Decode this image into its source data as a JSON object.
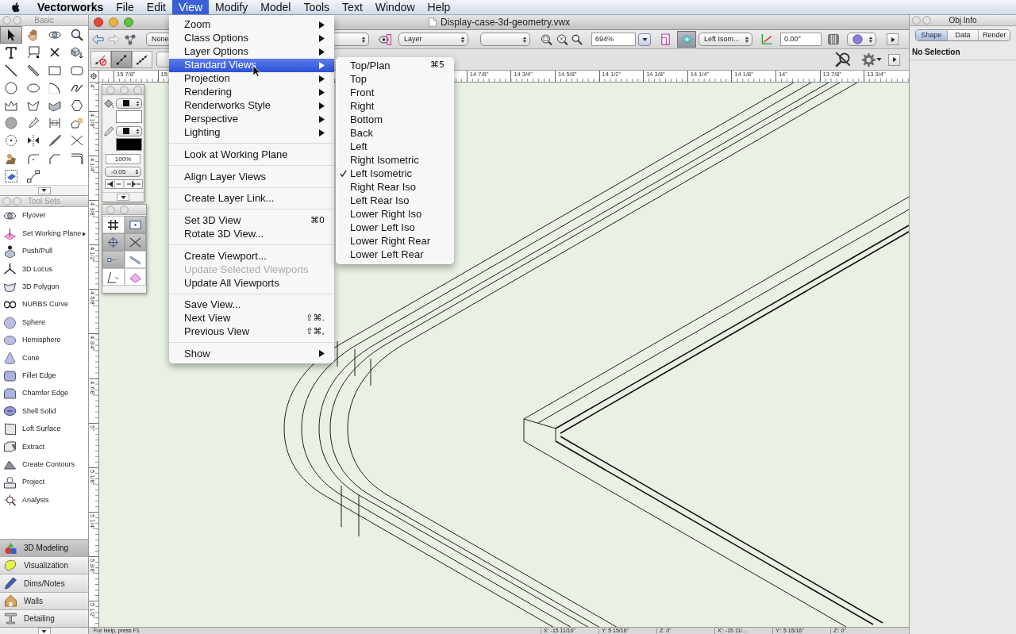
{
  "menu_bar": {
    "app_name": "Vectorworks",
    "menus": [
      {
        "label": "File",
        "selected": false
      },
      {
        "label": "Edit",
        "selected": false
      },
      {
        "label": "View",
        "selected": true
      },
      {
        "label": "Modify",
        "selected": false
      },
      {
        "label": "Model",
        "selected": false
      },
      {
        "label": "Tools",
        "selected": false
      },
      {
        "label": "Text",
        "selected": false
      },
      {
        "label": "Window",
        "selected": false
      },
      {
        "label": "Help",
        "selected": false
      }
    ]
  },
  "basic_palette": {
    "title": "Basic",
    "tools": [
      {
        "selected": true
      },
      {
        "selected": false
      },
      {
        "selected": false
      },
      {
        "selected": false
      },
      {
        "selected": false
      },
      {
        "selected": false
      },
      {
        "selected": false
      },
      {
        "selected": false
      },
      {
        "selected": false
      },
      {
        "selected": false
      },
      {
        "selected": false
      },
      {
        "selected": false
      },
      {
        "selected": false
      },
      {
        "selected": false
      },
      {
        "selected": false
      },
      {
        "selected": false
      },
      {
        "selected": false
      },
      {
        "selected": false
      },
      {
        "selected": false
      },
      {
        "selected": false
      },
      {
        "selected": false
      },
      {
        "selected": false
      },
      {
        "selected": false
      },
      {
        "selected": false
      },
      {
        "selected": false
      },
      {
        "selected": false
      },
      {
        "selected": false
      },
      {
        "selected": false
      },
      {
        "selected": false
      },
      {
        "selected": false
      },
      {
        "selected": false
      },
      {
        "selected": false
      },
      {
        "selected": false
      },
      {
        "selected": false
      }
    ]
  },
  "tool_sets_palette": {
    "title": "Tool Sets",
    "tools": [
      {
        "label": "Flyover",
        "submenu": false
      },
      {
        "label": "Set Working Plane",
        "submenu": true
      },
      {
        "label": "Push/Pull",
        "submenu": false
      },
      {
        "label": "3D Locus",
        "submenu": false
      },
      {
        "label": "3D Polygon",
        "submenu": false
      },
      {
        "label": "NURBS Curve",
        "submenu": false
      },
      {
        "label": "Sphere",
        "submenu": false
      },
      {
        "label": "Hemisphere",
        "submenu": false
      },
      {
        "label": "Cone",
        "submenu": false
      },
      {
        "label": "Fillet Edge",
        "submenu": false
      },
      {
        "label": "Chamfer Edge",
        "submenu": false
      },
      {
        "label": "Shell Solid",
        "submenu": false
      },
      {
        "label": "Loft Surface",
        "submenu": false
      },
      {
        "label": "Extract",
        "submenu": false
      },
      {
        "label": "Create Contours",
        "submenu": false
      },
      {
        "label": "Project",
        "submenu": false
      },
      {
        "label": "Analysis",
        "submenu": false
      }
    ],
    "categories": [
      {
        "label": "3D Modeling",
        "selected": true
      },
      {
        "label": "Visualization",
        "selected": false
      },
      {
        "label": "Dims/Notes",
        "selected": false
      },
      {
        "label": "Walls",
        "selected": false
      },
      {
        "label": "Detailing",
        "selected": false
      }
    ]
  },
  "document_window": {
    "title": "Display-case-3d-geometry.vwx",
    "view_bar": {
      "class": "None",
      "layer": "Layer",
      "zoom": "694%",
      "view": "Left Isom...",
      "angle": "0.00°",
      "toggles": [
        {
          "selected": false
        },
        {
          "selected": true
        }
      ]
    },
    "mode_buttons": [
      {
        "selected": false
      },
      {
        "selected": true
      },
      {
        "selected": false
      }
    ],
    "horizontal_ruler": [
      "15 7/8\"",
      "15",
      "14 7/8\"",
      "14 3/4\"",
      "14 5/8\"",
      "14 1/2\"",
      "14 3/8\"",
      "14 1/4\"",
      "14 1/8\"",
      "14\"",
      "13 7/8\"",
      "13 3/4\""
    ],
    "vertical_ruler": [
      "4\"",
      "4 1/8\"",
      "4 1/4\"",
      "4 3/8\"",
      "4 1/2\"",
      "4 5/8\"",
      "4 3/4\"",
      "4 7/8\"",
      "5\"",
      "5 1/8\"",
      "5 1/4\"",
      "5 3/8\"",
      "5 1/2\""
    ],
    "status_bar": {
      "help": "For Help, press F1",
      "coordinates": [
        "X: -15 11/16\"",
        "Y: 5 15/16\"",
        "Z: 0\"",
        "X': -15 11/...",
        "Y': 5 15/16\"",
        "Z': 0\""
      ]
    }
  },
  "attributes_palette": {
    "swatches": [
      {
        "color": "#ffffff"
      },
      {
        "color": "#000000"
      }
    ],
    "opacity": "100%",
    "line_thickness": "-0.05"
  },
  "snap_palette": {
    "buttons": [
      {
        "selected": false
      },
      {
        "selected": true
      },
      {
        "selected": true
      },
      {
        "selected": true
      },
      {
        "selected": true
      },
      {
        "selected": false
      },
      {
        "selected": false
      },
      {
        "selected": false
      }
    ]
  },
  "view_menu": {
    "groups": [
      {
        "items": [
          {
            "label": "Zoom",
            "submenu": true,
            "disabled": false,
            "selected": false
          },
          {
            "label": "Class Options",
            "submenu": true,
            "disabled": false,
            "selected": false
          },
          {
            "label": "Layer Options",
            "submenu": true,
            "disabled": false,
            "selected": false
          },
          {
            "label": "Standard Views",
            "submenu": true,
            "disabled": false,
            "selected": true
          },
          {
            "label": "Projection",
            "submenu": true,
            "disabled": false,
            "selected": false
          },
          {
            "label": "Rendering",
            "submenu": true,
            "disabled": false,
            "selected": false
          },
          {
            "label": "Renderworks Style",
            "submenu": true,
            "disabled": false,
            "selected": false
          },
          {
            "label": "Perspective",
            "submenu": true,
            "disabled": false,
            "selected": false
          },
          {
            "label": "Lighting",
            "submenu": true,
            "disabled": false,
            "selected": false
          }
        ]
      },
      {
        "items": [
          {
            "label": "Look at Working Plane",
            "submenu": false,
            "disabled": false,
            "selected": false
          }
        ]
      },
      {
        "items": [
          {
            "label": "Align Layer Views",
            "submenu": false,
            "disabled": false,
            "selected": false
          }
        ]
      },
      {
        "items": [
          {
            "label": "Create Layer Link...",
            "submenu": false,
            "disabled": false,
            "selected": false
          }
        ]
      },
      {
        "items": [
          {
            "label": "Set 3D View",
            "shortcut": "⌘0",
            "submenu": false,
            "disabled": false,
            "selected": false
          },
          {
            "label": "Rotate 3D View...",
            "submenu": false,
            "disabled": false,
            "selected": false
          }
        ]
      },
      {
        "items": [
          {
            "label": "Create Viewport...",
            "submenu": false,
            "disabled": false,
            "selected": false
          },
          {
            "label": "Update Selected Viewports",
            "submenu": false,
            "disabled": true,
            "selected": false
          },
          {
            "label": "Update All Viewports",
            "submenu": false,
            "disabled": false,
            "selected": false
          }
        ]
      },
      {
        "items": [
          {
            "label": "Save View...",
            "submenu": false,
            "disabled": false,
            "selected": false
          },
          {
            "label": "Next View",
            "shortcut": "⇧⌘.",
            "submenu": false,
            "disabled": false,
            "selected": false
          },
          {
            "label": "Previous View",
            "shortcut": "⇧⌘,",
            "submenu": false,
            "disabled": false,
            "selected": false
          }
        ]
      },
      {
        "items": [
          {
            "label": "Show",
            "submenu": true,
            "disabled": false,
            "selected": false
          }
        ]
      }
    ]
  },
  "standard_views_submenu": {
    "items": [
      {
        "label": "Top/Plan",
        "shortcut": "⌘5",
        "checked": false,
        "selected": false
      },
      {
        "label": "Top",
        "checked": false,
        "selected": false
      },
      {
        "label": "Front",
        "checked": false,
        "selected": false
      },
      {
        "label": "Right",
        "checked": false,
        "selected": false
      },
      {
        "label": "Bottom",
        "checked": false,
        "selected": false
      },
      {
        "label": "Back",
        "checked": false,
        "selected": false
      },
      {
        "label": "Left",
        "checked": false,
        "selected": false
      },
      {
        "label": "Right Isometric",
        "checked": false,
        "selected": false
      },
      {
        "label": "Left Isometric",
        "checked": true,
        "selected": false
      },
      {
        "label": "Right Rear Iso",
        "checked": false,
        "selected": false
      },
      {
        "label": "Left Rear Iso",
        "checked": false,
        "selected": false
      },
      {
        "label": "Lower Right Iso",
        "checked": false,
        "selected": false
      },
      {
        "label": "Lower Left Iso",
        "checked": false,
        "selected": false
      },
      {
        "label": "Lower Right Rear",
        "checked": false,
        "selected": false
      },
      {
        "label": "Lower Left Rear",
        "checked": false,
        "selected": false
      }
    ]
  },
  "obj_info_palette": {
    "title": "Obj Info",
    "tabs": [
      {
        "label": "Shape",
        "selected": true
      },
      {
        "label": "Data",
        "selected": false
      },
      {
        "label": "Render",
        "selected": false
      }
    ],
    "selection": "No Selection"
  }
}
